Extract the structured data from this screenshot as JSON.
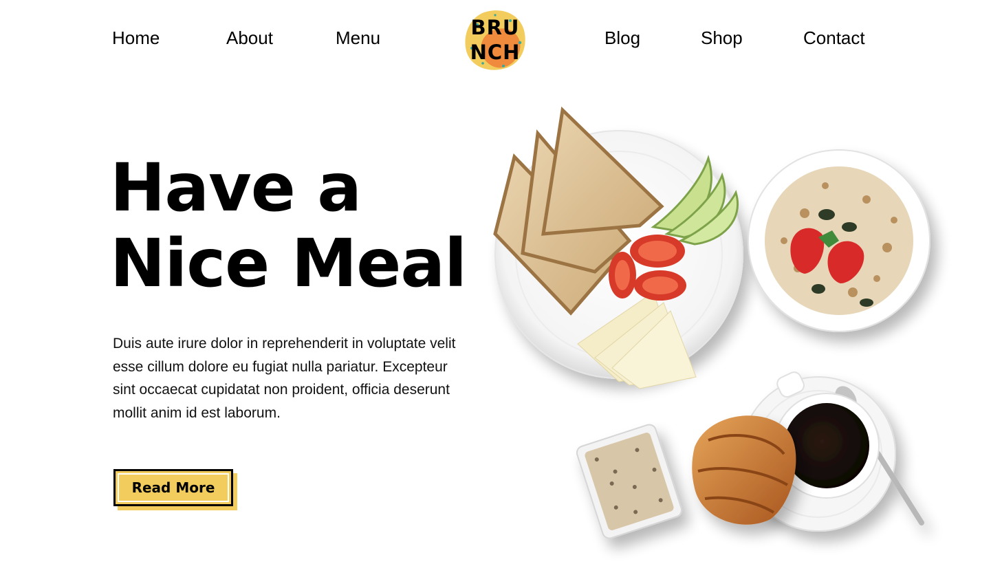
{
  "nav": {
    "left": [
      "Home",
      "About",
      "Menu"
    ],
    "right": [
      "Blog",
      "Shop",
      "Contact"
    ],
    "logo": {
      "line1": "BRU",
      "line2": "NCH"
    }
  },
  "hero": {
    "title_line1": "Have a",
    "title_line2": "Nice Meal",
    "description": "Duis aute irure dolor in reprehenderit in voluptate velit esse cillum dolore eu fugiat nulla pariatur. Excepteur sint occaecat cupidatat non proident, officia deserunt mollit anim id est laborum.",
    "button_label": "Read More"
  },
  "colors": {
    "accent": "#f2cc5c",
    "logo_orange": "#f08a3c",
    "text": "#000000",
    "background": "#ffffff"
  },
  "icons": {
    "logo": "brunch-logo-icon",
    "food_image": "breakfast-spread-image"
  }
}
